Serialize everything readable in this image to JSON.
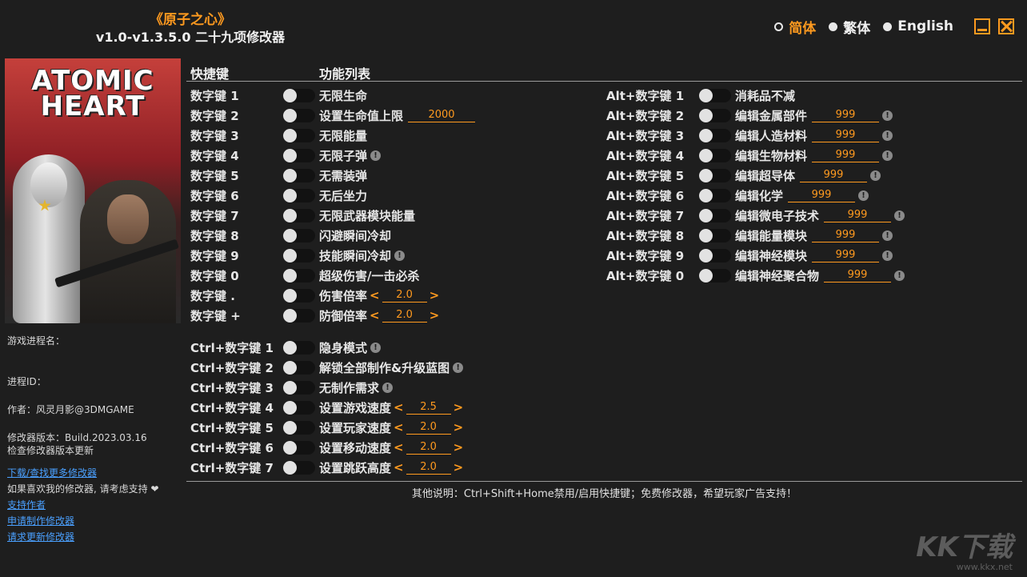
{
  "title": {
    "main": "《原子之心》",
    "sub": "v1.0-v1.3.5.0 二十九项修改器"
  },
  "languages": [
    {
      "label": "简体",
      "active": true
    },
    {
      "label": "繁体",
      "active": false
    },
    {
      "label": "English",
      "active": false
    }
  ],
  "cover": {
    "title_line1": "ATOMIC",
    "title_line2": "HEART"
  },
  "sidebar": {
    "process_name_label": "游戏进程名：",
    "process_id_label": "进程ID：",
    "author": "作者：风灵月影@3DMGAME",
    "version": "修改器版本：Build.2023.03.16",
    "check_update": "检查修改器版本更新",
    "download_link": "下载/查找更多修改器",
    "support_text": "如果喜欢我的修改器, 请考虑支持 ❤",
    "support_author": "支持作者",
    "request_make": "申请制作修改器",
    "request_update": "请求更新修改器"
  },
  "headers": {
    "hotkey": "快捷键",
    "function": "功能列表"
  },
  "left_rows": [
    {
      "hotkey": "数字键 1",
      "label": "无限生命"
    },
    {
      "hotkey": "数字键 2",
      "label": "设置生命值上限",
      "value": "2000"
    },
    {
      "hotkey": "数字键 3",
      "label": "无限能量"
    },
    {
      "hotkey": "数字键 4",
      "label": "无限子弹",
      "warn": "!"
    },
    {
      "hotkey": "数字键 5",
      "label": "无需装弹"
    },
    {
      "hotkey": "数字键 6",
      "label": "无后坐力"
    },
    {
      "hotkey": "数字键 7",
      "label": "无限武器模块能量"
    },
    {
      "hotkey": "数字键 8",
      "label": "闪避瞬间冷却"
    },
    {
      "hotkey": "数字键 9",
      "label": "技能瞬间冷却",
      "warn": "!"
    },
    {
      "hotkey": "数字键 0",
      "label": "超级伤害/一击必杀"
    },
    {
      "hotkey": "数字键 .",
      "label": "伤害倍率",
      "stepper": "2.0"
    },
    {
      "hotkey": "数字键 +",
      "label": "防御倍率",
      "stepper": "2.0"
    }
  ],
  "ctrl_rows": [
    {
      "hotkey": "Ctrl+数字键 1",
      "label": "隐身模式",
      "warn": "!"
    },
    {
      "hotkey": "Ctrl+数字键 2",
      "label": "解锁全部制作&升级蓝图",
      "warn": "!"
    },
    {
      "hotkey": "Ctrl+数字键 3",
      "label": "无制作需求",
      "warn": "!"
    },
    {
      "hotkey": "Ctrl+数字键 4",
      "label": "设置游戏速度",
      "stepper": "2.5"
    },
    {
      "hotkey": "Ctrl+数字键 5",
      "label": "设置玩家速度",
      "stepper": "2.0"
    },
    {
      "hotkey": "Ctrl+数字键 6",
      "label": "设置移动速度",
      "stepper": "2.0"
    },
    {
      "hotkey": "Ctrl+数字键 7",
      "label": "设置跳跃高度",
      "stepper": "2.0"
    }
  ],
  "alt_rows": [
    {
      "hotkey": "Alt+数字键 1",
      "label": "消耗品不减"
    },
    {
      "hotkey": "Alt+数字键 2",
      "label": "编辑金属部件",
      "value": "999",
      "warn": "!"
    },
    {
      "hotkey": "Alt+数字键 3",
      "label": "编辑人造材料",
      "value": "999",
      "warn": "!"
    },
    {
      "hotkey": "Alt+数字键 4",
      "label": "编辑生物材料",
      "value": "999",
      "warn": "!"
    },
    {
      "hotkey": "Alt+数字键 5",
      "label": "编辑超导体",
      "value": "999",
      "warn": "!"
    },
    {
      "hotkey": "Alt+数字键 6",
      "label": "编辑化学",
      "value": "999",
      "warn": "!"
    },
    {
      "hotkey": "Alt+数字键 7",
      "label": "编辑微电子技术",
      "value": "999",
      "warn": "!"
    },
    {
      "hotkey": "Alt+数字键 8",
      "label": "编辑能量模块",
      "value": "999",
      "warn": "!"
    },
    {
      "hotkey": "Alt+数字键 9",
      "label": "编辑神经模块",
      "value": "999",
      "warn": "!"
    },
    {
      "hotkey": "Alt+数字键 0",
      "label": "编辑神经聚合物",
      "value": "999",
      "warn": "!"
    }
  ],
  "footer_note": "其他说明：Ctrl+Shift+Home禁用/启用快捷键；免费修改器，希望玩家广告支持！",
  "watermark": {
    "big": "KK下载",
    "small": "www.kkx.net"
  },
  "colors": {
    "accent": "#ff9a1f",
    "background": "#1e1e1e",
    "link": "#4aa0ff"
  },
  "icons": {
    "warn": "exclamation-circle-icon",
    "minimize": "minimize-icon",
    "close": "close-icon"
  }
}
